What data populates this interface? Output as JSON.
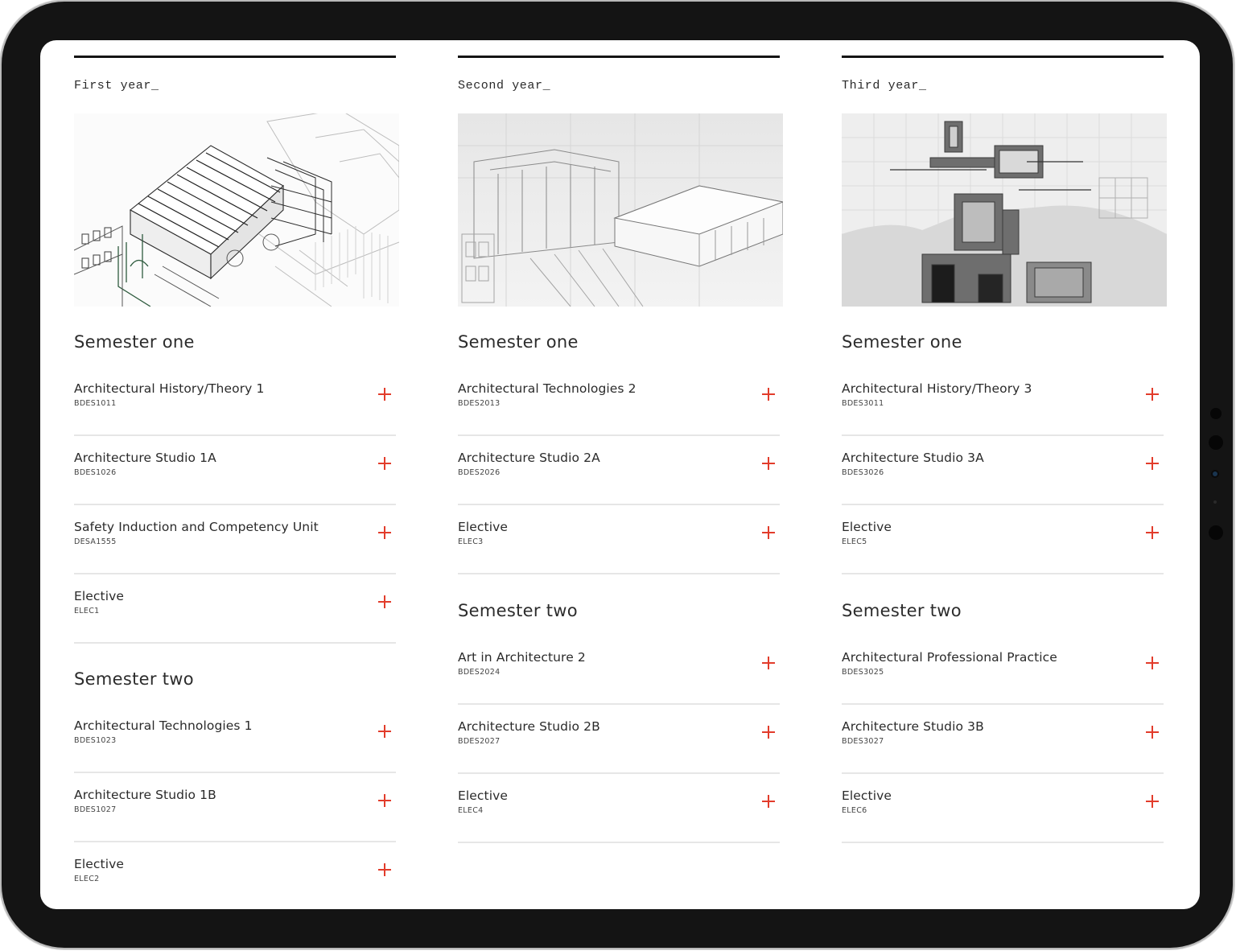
{
  "years": [
    {
      "label": "First year_",
      "semesters": [
        {
          "title": "Semester one",
          "courses": [
            {
              "name": "Architectural History/Theory 1",
              "code": "BDES1011"
            },
            {
              "name": "Architecture Studio 1A",
              "code": "BDES1026"
            },
            {
              "name": "Safety Induction and Competency Unit",
              "code": "DESA1555"
            },
            {
              "name": "Elective",
              "code": "ELEC1"
            }
          ]
        },
        {
          "title": "Semester two",
          "courses": [
            {
              "name": "Architectural Technologies 1",
              "code": "BDES1023"
            },
            {
              "name": "Architecture Studio 1B",
              "code": "BDES1027"
            },
            {
              "name": "Elective",
              "code": "ELEC2"
            }
          ]
        }
      ]
    },
    {
      "label": "Second year_",
      "semesters": [
        {
          "title": "Semester one",
          "courses": [
            {
              "name": "Architectural Technologies 2",
              "code": "BDES2013"
            },
            {
              "name": "Architecture Studio 2A",
              "code": "BDES2026"
            },
            {
              "name": "Elective",
              "code": "ELEC3"
            }
          ]
        },
        {
          "title": "Semester two",
          "courses": [
            {
              "name": "Art in Architecture 2",
              "code": "BDES2024"
            },
            {
              "name": "Architecture Studio 2B",
              "code": "BDES2027"
            },
            {
              "name": "Elective",
              "code": "ELEC4"
            }
          ]
        }
      ]
    },
    {
      "label": "Third year_",
      "semesters": [
        {
          "title": "Semester one",
          "courses": [
            {
              "name": "Architectural History/Theory 3",
              "code": "BDES3011"
            },
            {
              "name": "Architecture Studio 3A",
              "code": "BDES3026"
            },
            {
              "name": "Elective",
              "code": "ELEC5"
            }
          ]
        },
        {
          "title": "Semester two",
          "courses": [
            {
              "name": "Architectural Professional Practice",
              "code": "BDES3025"
            },
            {
              "name": "Architecture Studio 3B",
              "code": "BDES3027"
            },
            {
              "name": "Elective",
              "code": "ELEC6"
            }
          ]
        }
      ]
    }
  ],
  "icons": {
    "expand": "plus-icon"
  },
  "colors": {
    "accent": "#e23c2b",
    "rule": "#151515",
    "divider": "#e6e6e6",
    "bezel": "#141414"
  }
}
